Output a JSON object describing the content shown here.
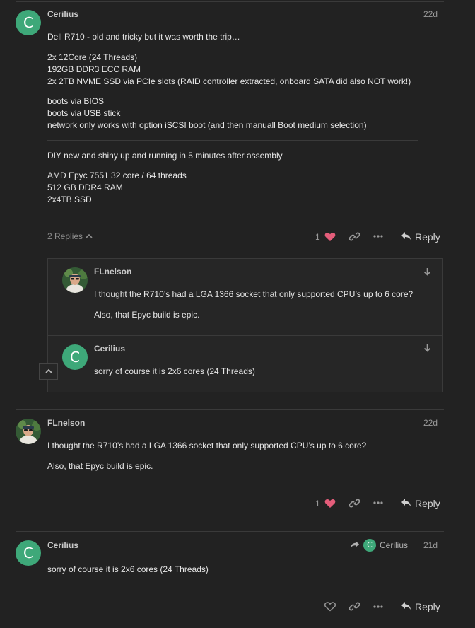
{
  "post1": {
    "avatar_letter": "C",
    "username": "Cerilius",
    "date": "22d",
    "lines": [
      "Dell R710 - old and tricky but it was worth the trip…",
      "2x 12Core (24 Threads)",
      "192GB DDR3 ECC RAM",
      "2x 2TB NVME SSD via PCIe slots (RAID controller extracted, onboard SATA did also NOT work!)",
      "boots via BIOS",
      "boots via USB stick",
      "network only works with option iSCSI boot (and then manuall Boot medium selection)",
      "DIY new and shiny up and running in 5 minutes after assembly",
      "AMD Epyc 7551 32 core / 64 threads",
      "512 GB DDR4 RAM",
      "2x4TB SSD"
    ],
    "replies_label": "2 Replies",
    "like_count": "1",
    "reply_label": "Reply"
  },
  "embedded": [
    {
      "username": "FLnelson",
      "lines": [
        "I thought the R710’s had a LGA 1366 socket that only supported CPU’s up to 6 core?",
        "Also, that Epyc build is epic."
      ]
    },
    {
      "avatar_letter": "C",
      "username": "Cerilius",
      "lines": [
        "sorry of course it is 2x6 cores (24 Threads)"
      ]
    }
  ],
  "post2": {
    "username": "FLnelson",
    "date": "22d",
    "lines": [
      "I thought the R710’s had a LGA 1366 socket that only supported CPU’s up to 6 core?",
      "Also, that Epyc build is epic."
    ],
    "like_count": "1",
    "reply_label": "Reply"
  },
  "post3": {
    "avatar_letter": "C",
    "username": "Cerilius",
    "date": "21d",
    "reply_to_user": "Cerilius",
    "reply_to_letter": "C",
    "lines": [
      "sorry of course it is 2x6 cores (24 Threads)"
    ],
    "reply_label": "Reply"
  },
  "colors": {
    "background": "#222222",
    "avatar_green": "#3ea879",
    "heart_pink": "#e45d7a",
    "text": "#e6e6e6",
    "muted": "#9a9a9a"
  },
  "icons": [
    "heart-icon",
    "link-icon",
    "more-icon",
    "reply-icon",
    "chevron-up-icon",
    "arrow-down-icon",
    "share-arrow-icon"
  ]
}
